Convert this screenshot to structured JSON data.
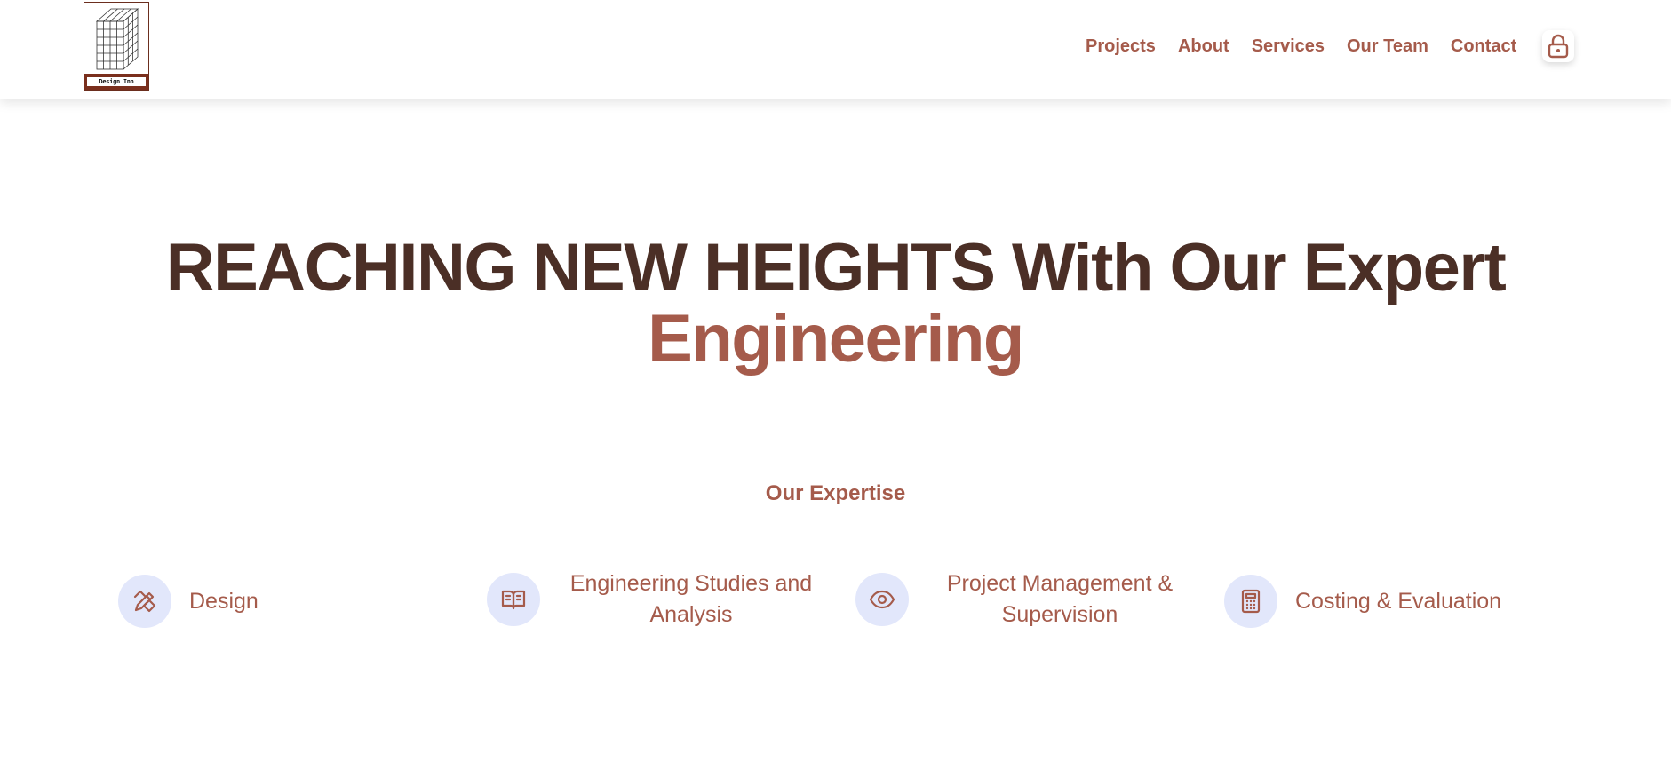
{
  "header": {
    "logo_text": "Design Inn",
    "nav": [
      "Projects",
      "About",
      "Services",
      "Our Team",
      "Contact"
    ],
    "lock_icon": "lock-icon"
  },
  "hero": {
    "line1": "REACHING NEW HEIGHTS With Our Expert",
    "line2": "Engineering"
  },
  "expertise": {
    "title": "Our Expertise",
    "items": [
      {
        "label": "Design",
        "icon": "pencil-ruler-icon"
      },
      {
        "label": "Engineering Studies and Analysis",
        "icon": "open-book-icon"
      },
      {
        "label": "Project Management & Supervision",
        "icon": "eye-icon"
      },
      {
        "label": "Costing & Evaluation",
        "icon": "calculator-icon"
      }
    ]
  },
  "colors": {
    "accent": "#a55b4b",
    "dark": "#4b2f26",
    "icon_bg": "#e2e7fb",
    "logo_brand": "#7a2f1d"
  }
}
